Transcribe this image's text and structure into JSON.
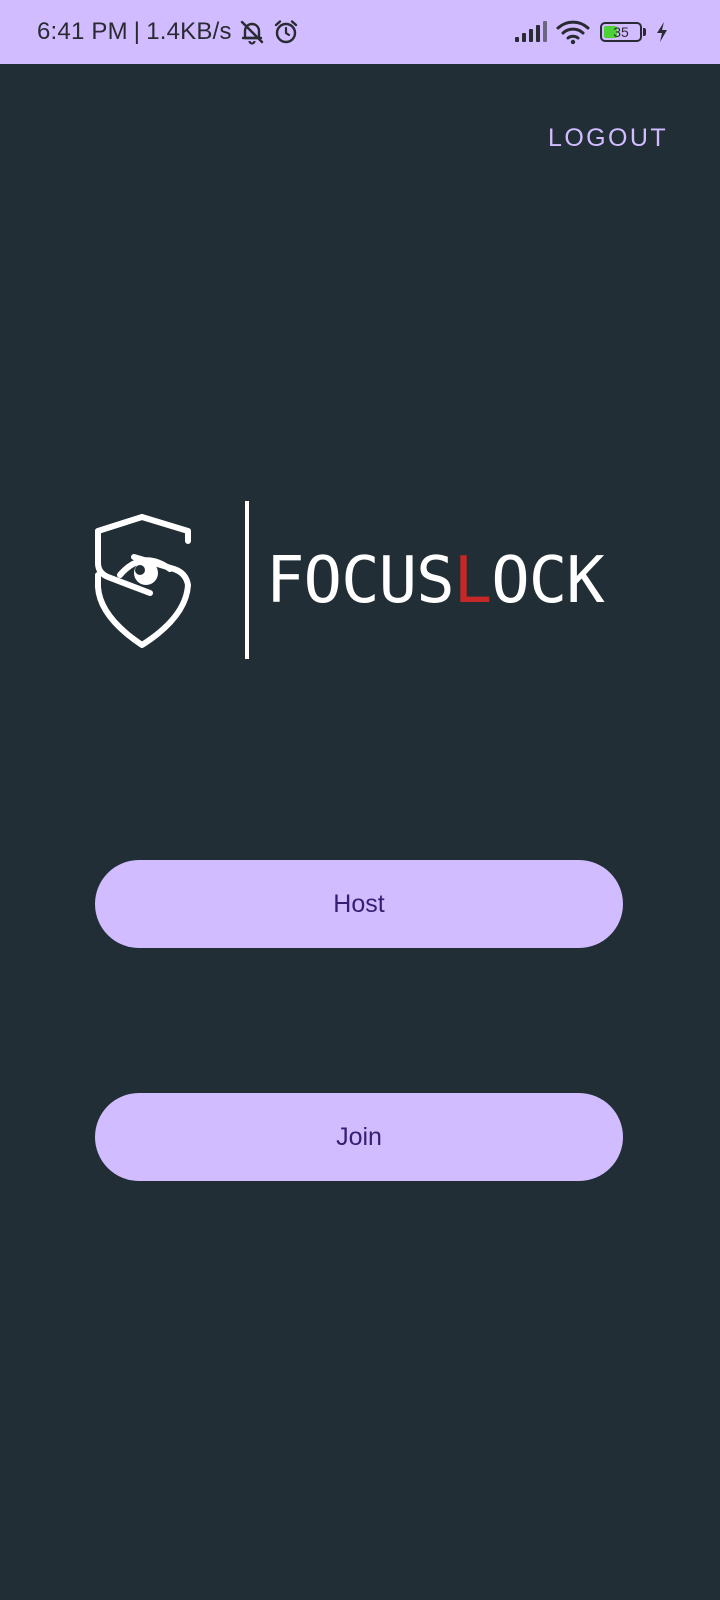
{
  "status_bar": {
    "time": "6:41 PM",
    "separator": "|",
    "net_speed": "1.4KB/s",
    "battery_level": "35",
    "icons": [
      "notifications-muted-icon",
      "alarm-icon",
      "signal-icon",
      "wifi-icon",
      "battery-icon",
      "charging-icon"
    ]
  },
  "header": {
    "logout_label": "LOGOUT"
  },
  "logo": {
    "text_before": "FOCUS",
    "text_accent": "L",
    "text_after": "OCK",
    "accent_color": "#c62828",
    "icon": "shield-eye-logo-icon"
  },
  "actions": {
    "host_label": "Host",
    "join_label": "Join"
  },
  "colors": {
    "background": "#222e35",
    "primary": "#d0bcff",
    "on_primary": "#381e72"
  }
}
